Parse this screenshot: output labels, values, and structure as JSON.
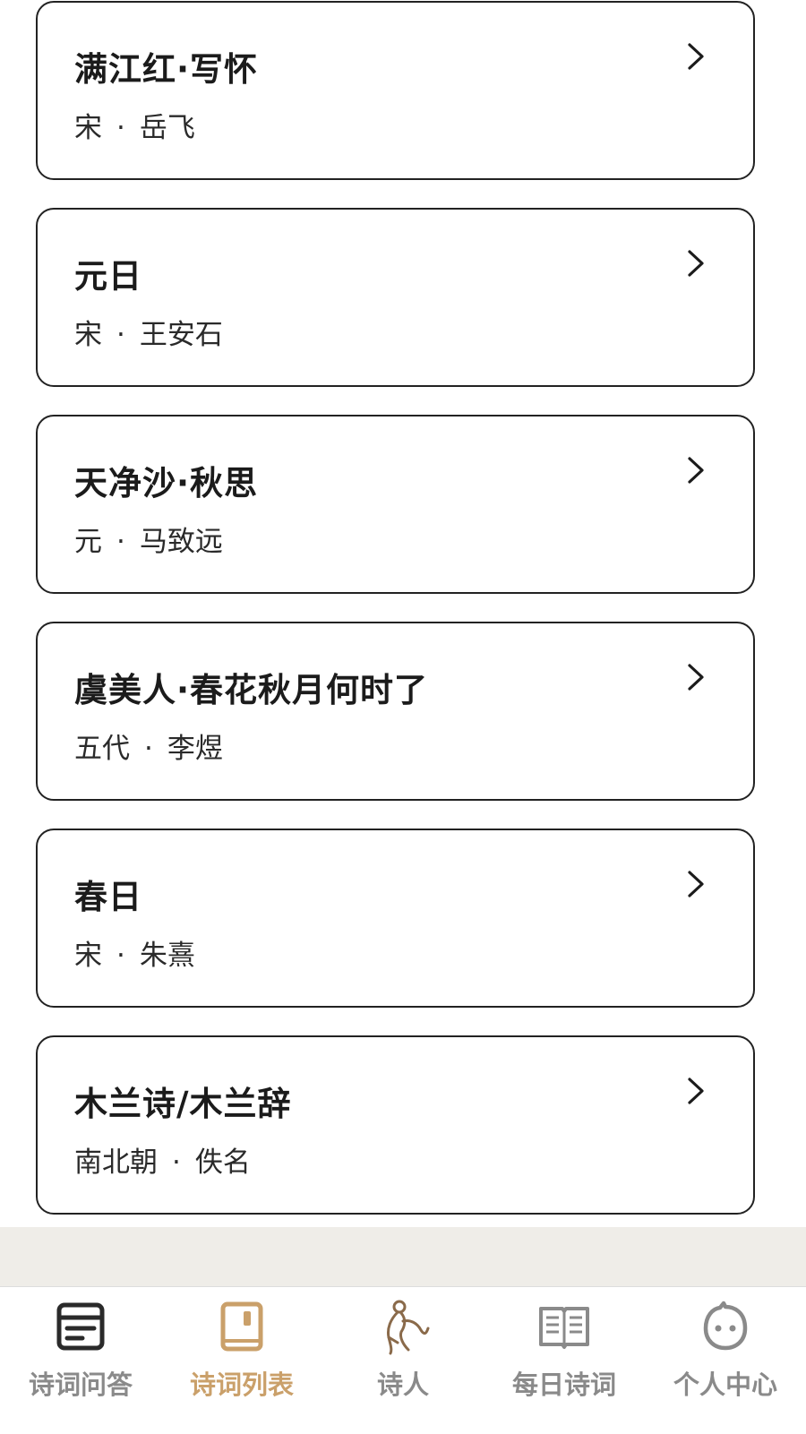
{
  "poems": [
    {
      "title": "满江红·写怀",
      "dynasty": "宋",
      "author": "岳飞"
    },
    {
      "title": "元日",
      "dynasty": "宋",
      "author": "王安石"
    },
    {
      "title": "天净沙·秋思",
      "dynasty": "元",
      "author": "马致远"
    },
    {
      "title": "虞美人·春花秋月何时了",
      "dynasty": "五代",
      "author": "李煜"
    },
    {
      "title": "春日",
      "dynasty": "宋",
      "author": "朱熹"
    },
    {
      "title": "木兰诗/木兰辞",
      "dynasty": "南北朝",
      "author": "佚名"
    }
  ],
  "separator": "·",
  "tabs": [
    {
      "label": "诗词问答",
      "icon": "qa-card-icon",
      "active": false
    },
    {
      "label": "诗词列表",
      "icon": "book-icon",
      "active": true
    },
    {
      "label": "诗人",
      "icon": "poet-figure-icon",
      "active": false
    },
    {
      "label": "每日诗词",
      "icon": "open-book-icon",
      "active": false
    },
    {
      "label": "个人中心",
      "icon": "face-icon",
      "active": false
    }
  ],
  "colors": {
    "active_tab": "#caa06a",
    "inactive_tab": "#8a8a8a",
    "card_border": "#222222",
    "strip": "#efede8"
  }
}
